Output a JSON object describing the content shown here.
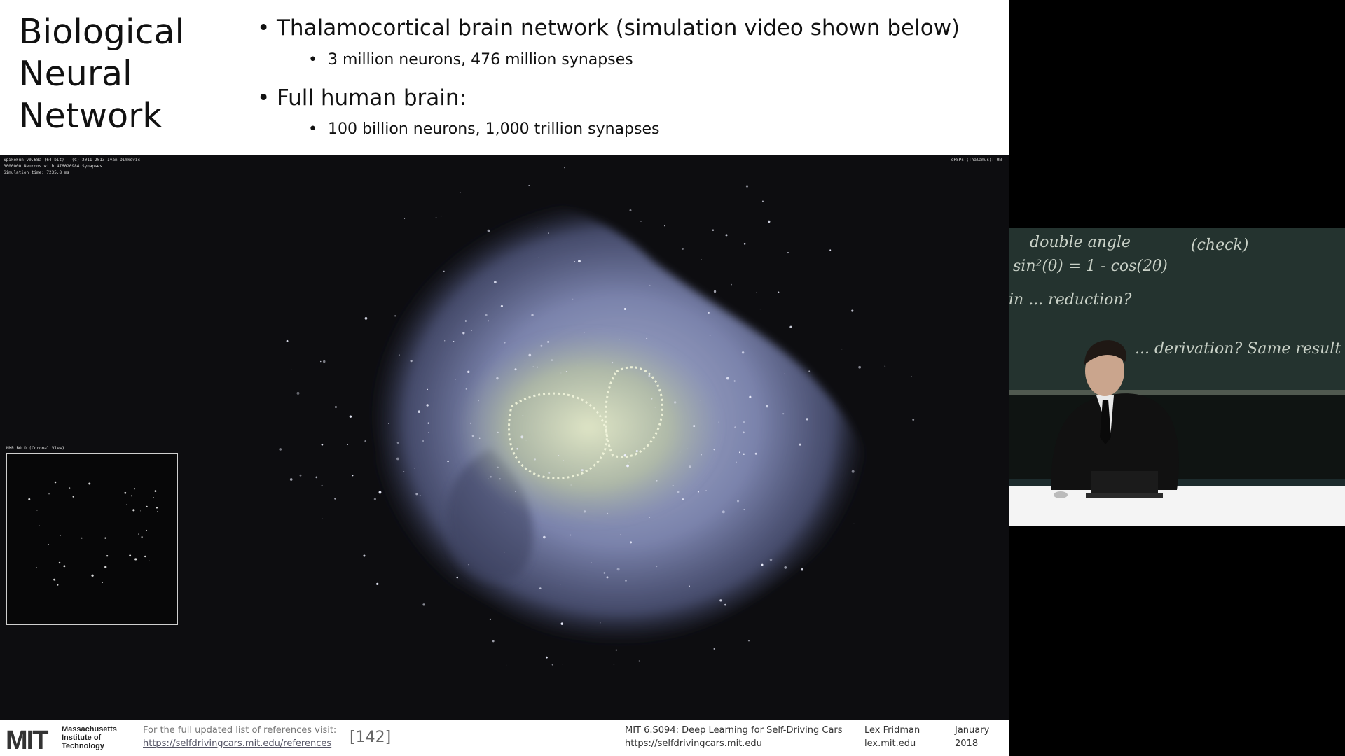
{
  "slide": {
    "title_lines": [
      "Biological",
      "Neural",
      "Network"
    ],
    "bullets": [
      {
        "text": "Thalamocortical brain network (simulation video shown below)",
        "sub": [
          "3 million neurons, 476 million synapses"
        ]
      },
      {
        "text": "Full human brain:",
        "sub": [
          "100 billion neurons, 1,000 trillion synapses"
        ]
      }
    ],
    "bullet_glyph": "•"
  },
  "video": {
    "header_left": [
      "SpikeFun v0.68a (64-bit) - (C) 2011-2013 Ivan Dimkovic",
      "3000000 Neurons with 476020984 Synapses",
      "Simulation time: 7235.8 ms"
    ],
    "header_right": "ePSPs (Thalamus): ON",
    "minimap_label": "NMR BOLD (Coronal View)"
  },
  "footer": {
    "logo_text": "MIT",
    "institute": [
      "Massachusetts",
      "Institute of",
      "Technology"
    ],
    "refs_label": "For the full updated list of references visit:",
    "refs_url": "https://selfdrivingcars.mit.edu/references",
    "ref_number": "[142]",
    "course": "MIT 6.S094: Deep Learning for Self-Driving Cars",
    "course_url": "https://selfdrivingcars.mit.edu",
    "author": "Lex Fridman",
    "author_url": "lex.mit.edu",
    "month": "January",
    "year": "2018"
  },
  "camera": {
    "chalk_lines": [
      "double angle",
      "(check)",
      "sin²(θ) = 1 - cos(2θ)",
      "in ... reduction?",
      "... derivation? Same result"
    ]
  },
  "colors": {
    "accent_header_bg": "#ffffff",
    "video_bg": "#0d0d10",
    "brain_blue": "#8a93c4",
    "brain_core": "#b7c2a0",
    "chalkboard": "#24332f"
  }
}
